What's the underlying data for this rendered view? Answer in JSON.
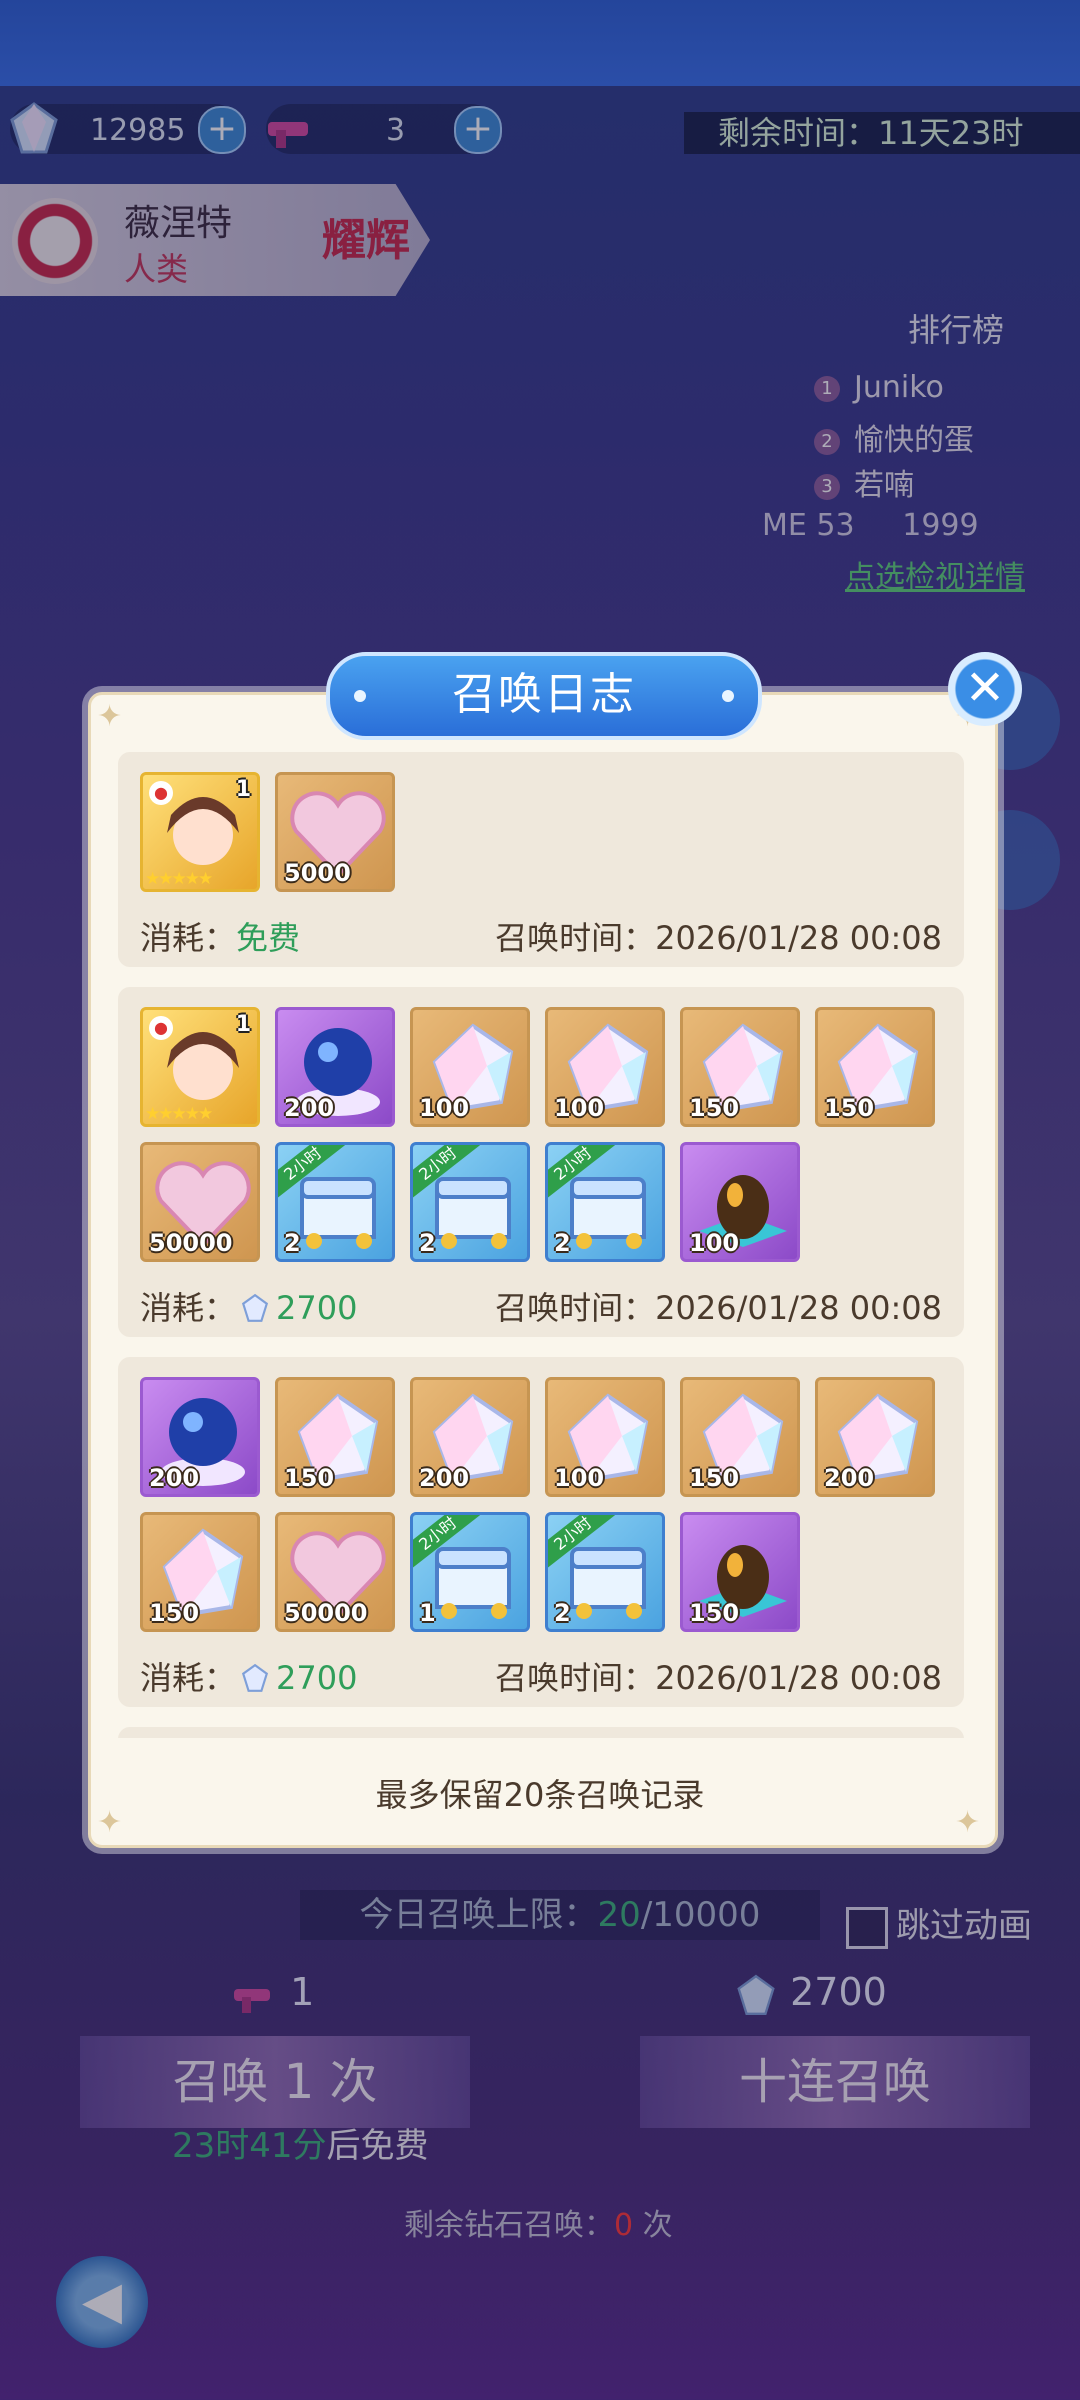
{
  "top_resources": {
    "diamonds": "12985",
    "tickets": "3"
  },
  "event": {
    "time_left": "剩余时间：11天23时"
  },
  "character": {
    "name": "薇涅特",
    "race": "人类",
    "rank_badge": "耀辉"
  },
  "ranking": {
    "title": "排行榜",
    "entries": [
      "Juniko",
      "愉快的蛋",
      "若喃"
    ],
    "numbers": [
      "1",
      "2",
      "3"
    ],
    "my_score_label": "ME 53",
    "my_score": "1999",
    "detail_link": "点选检视详情"
  },
  "dialog": {
    "title": "召唤日志",
    "close_icon": "close-icon",
    "footer_note": "最多保留20条召唤记录",
    "cost_label": "消耗：",
    "time_label": "召唤时间：",
    "entries": [
      {
        "items": [
          {
            "kind": "character",
            "level": "1",
            "qty": ""
          },
          {
            "kind": "exp-heart",
            "level": "",
            "qty": "5000"
          }
        ],
        "cost": "免费",
        "time": "2026/01/28 00:08"
      },
      {
        "items": [
          {
            "kind": "character",
            "level": "1",
            "qty": ""
          },
          {
            "kind": "crystal-orb",
            "qty": "200"
          },
          {
            "kind": "prism-gem",
            "qty": "100"
          },
          {
            "kind": "prism-gem",
            "qty": "100"
          },
          {
            "kind": "prism-gem",
            "qty": "150"
          },
          {
            "kind": "prism-gem",
            "qty": "150"
          },
          {
            "kind": "exp-heart",
            "qty": "50000"
          },
          {
            "kind": "treasure-chest",
            "qty": "2",
            "ribbon": "2小时"
          },
          {
            "kind": "treasure-chest",
            "qty": "2",
            "ribbon": "2小时"
          },
          {
            "kind": "treasure-chest",
            "qty": "2",
            "ribbon": "2小时"
          },
          {
            "kind": "gold-egg",
            "qty": "100"
          }
        ],
        "cost": "2700",
        "time": "2026/01/28 00:08"
      },
      {
        "items": [
          {
            "kind": "crystal-orb",
            "qty": "200"
          },
          {
            "kind": "prism-gem",
            "qty": "150"
          },
          {
            "kind": "prism-gem",
            "qty": "200"
          },
          {
            "kind": "prism-gem",
            "qty": "100"
          },
          {
            "kind": "prism-gem",
            "qty": "150"
          },
          {
            "kind": "prism-gem",
            "qty": "200"
          },
          {
            "kind": "prism-gem",
            "qty": "150"
          },
          {
            "kind": "exp-heart",
            "qty": "50000"
          },
          {
            "kind": "treasure-chest",
            "qty": "1",
            "ribbon": "2小时"
          },
          {
            "kind": "treasure-chest",
            "qty": "2",
            "ribbon": "2小时"
          },
          {
            "kind": "gold-egg",
            "qty": "150"
          }
        ],
        "cost": "2700",
        "time": "2026/01/28 00:08"
      },
      {
        "items": [
          {
            "kind": "character",
            "level": "1",
            "qty": ""
          },
          {
            "kind": "crystal-orb",
            "qty": ""
          },
          {
            "kind": "crystal-orb",
            "qty": ""
          },
          {
            "kind": "prism-gem",
            "qty": ""
          },
          {
            "kind": "prism-gem",
            "qty": ""
          },
          {
            "kind": "exp-heart",
            "qty": ""
          }
        ],
        "cost": "",
        "time": ""
      }
    ]
  },
  "summon": {
    "daily_limit_label": "今日召唤上限：",
    "daily_used": "20",
    "daily_max": "/10000",
    "skip_animation": "跳过动画",
    "single_cost": "1",
    "ten_cost": "2700",
    "single_button": "召唤 1 次",
    "ten_button": "十连召唤",
    "free_timer": "23时41分",
    "free_suffix": "后免费",
    "remaining_label": "剩余钻石召唤：",
    "remaining_count": "0",
    "remaining_unit": "次"
  },
  "colors": {
    "accent_blue": "#3a8ee6",
    "green": "#2f9e5a",
    "dialog_bg": "#faf6ec"
  }
}
